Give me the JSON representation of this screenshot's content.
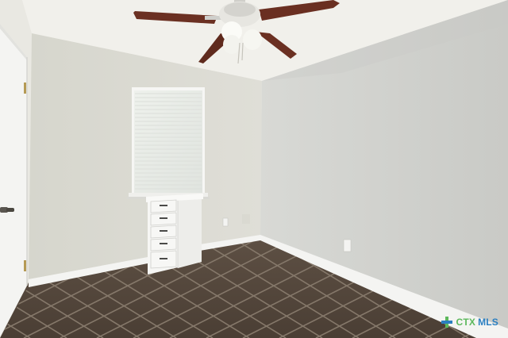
{
  "scene": {
    "description_free": true,
    "colors": {
      "wall_left": "#dcdcd3",
      "wall_right": "#d2d3cf",
      "ceiling": "#f3f2ee",
      "floor_tile": "#5a4c40",
      "grout": "#85786a",
      "baseboard": "#f4f4f2",
      "fan_blade": "#6b3022",
      "door": "#f4f4f2",
      "dresser": "#f6f6f4",
      "window_blind": "#f2f3f1"
    }
  },
  "watermark": {
    "brand_part1": "CTX",
    "brand_part2": "MLS"
  }
}
